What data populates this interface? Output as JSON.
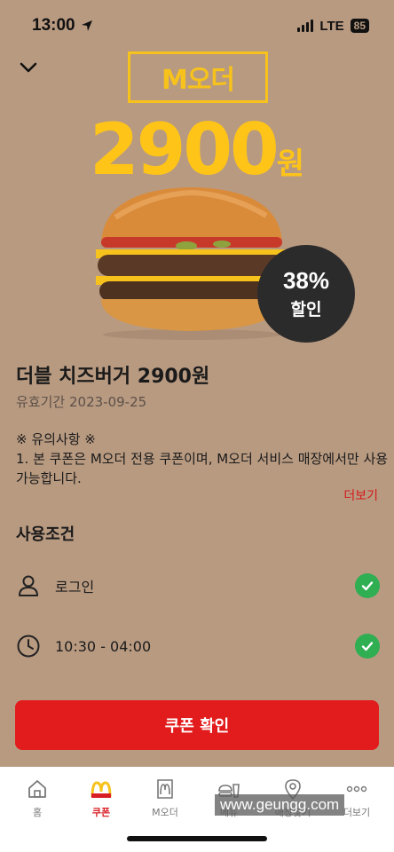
{
  "status_bar": {
    "time": "13:00",
    "network": "LTE",
    "battery": "85"
  },
  "header": {
    "brand_label": "M오더"
  },
  "hero": {
    "price_number": "2900",
    "price_unit": "원"
  },
  "badge": {
    "percent": "38%",
    "label": "할인"
  },
  "coupon": {
    "title": "더블 치즈버거 2900원",
    "validity_label": "유효기간",
    "validity_date": "2023-09-25"
  },
  "notice": {
    "title": "※ 유의사항 ※",
    "body": "1. 본 쿠폰은 M오더 전용 쿠폰이며, M오더 서비스 매장에서만 사용 가능합니다.",
    "more_label": "더보기"
  },
  "conditions": {
    "title": "사용조건",
    "items": [
      {
        "label": "로그인",
        "icon": "person-icon",
        "met": true
      },
      {
        "label": "10:30 - 04:00",
        "icon": "clock-icon",
        "met": true
      }
    ]
  },
  "action": {
    "confirm_label": "쿠폰 확인"
  },
  "tabbar": {
    "items": [
      {
        "label": "홈",
        "icon": "home-icon"
      },
      {
        "label": "쿠폰",
        "icon": "golden-arches-icon",
        "active": true
      },
      {
        "label": "M오더",
        "icon": "morder-icon"
      },
      {
        "label": "메뉴",
        "icon": "burger-drink-icon"
      },
      {
        "label": "매장찾기",
        "icon": "location-pin-icon"
      },
      {
        "label": "더보기",
        "icon": "more-dots-icon"
      }
    ]
  },
  "watermark": "www.geungg.com",
  "colors": {
    "background": "#b89a81",
    "accent_yellow": "#ffc418",
    "primary_red": "#e21c1c",
    "check_green": "#2fae52"
  }
}
